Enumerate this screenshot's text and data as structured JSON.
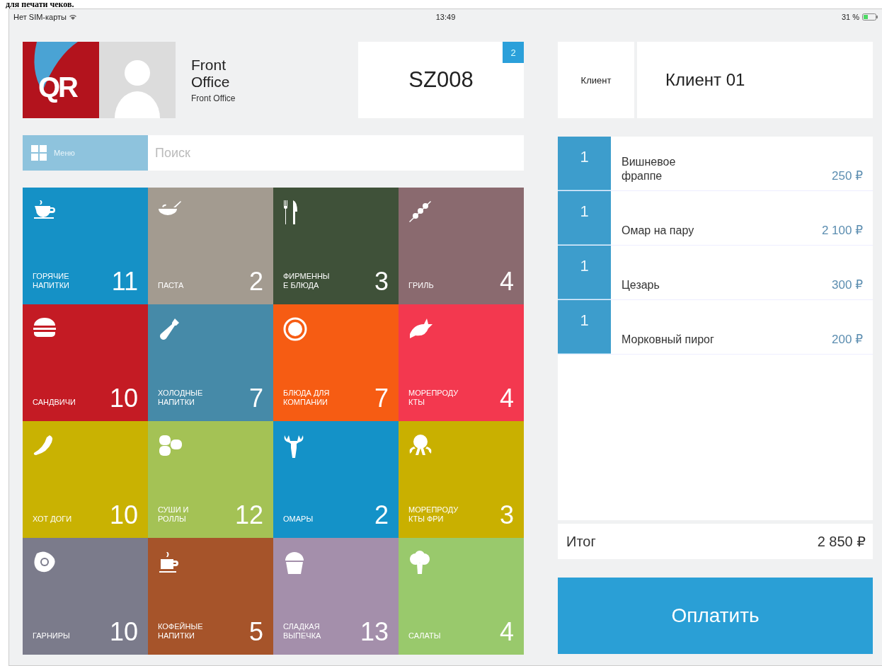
{
  "caption": "для печати чеков.",
  "status_bar": {
    "carrier": "Нет SIM-карты",
    "time": "13:49",
    "battery": "31 %"
  },
  "user": {
    "logo": "QR",
    "name": "Front Office",
    "role": "Front Office"
  },
  "order": {
    "number": "SZ008",
    "badge": "2"
  },
  "menu_button": "Меню",
  "search": {
    "placeholder": "Поиск"
  },
  "categories": [
    {
      "label": "ГОРЯЧИЕ\nНАПИТКИ",
      "count": "11",
      "color": "#1591c6"
    },
    {
      "label": "ПАСТА",
      "count": "2",
      "color": "#a39b90"
    },
    {
      "label": "ФИРМЕННЫ\nЕ БЛЮДА",
      "count": "3",
      "color": "#3f5139"
    },
    {
      "label": "ГРИЛЬ",
      "count": "4",
      "color": "#8a6a6f"
    },
    {
      "label": "САНДВИЧИ",
      "count": "10",
      "color": "#c41b24"
    },
    {
      "label": "ХОЛОДНЫЕ\nНАПИТКИ",
      "count": "7",
      "color": "#468aa8"
    },
    {
      "label": "БЛЮДА ДЛЯ\nКОМПАНИИ",
      "count": "7",
      "color": "#f65c13"
    },
    {
      "label": "МОРЕПРОДУ\nКТЫ",
      "count": "4",
      "color": "#f3384f"
    },
    {
      "label": "ХОТ ДОГИ",
      "count": "10",
      "color": "#c9b202"
    },
    {
      "label": "СУШИ И\nРОЛЛЫ",
      "count": "12",
      "color": "#a4c255"
    },
    {
      "label": "ОМАРЫ",
      "count": "2",
      "color": "#1492c8"
    },
    {
      "label": "МОРЕПРОДУ\nКТЫ ФРИ",
      "count": "3",
      "color": "#c9b000"
    },
    {
      "label": "ГАРНИРЫ",
      "count": "10",
      "color": "#7b7b8b"
    },
    {
      "label": "КОФЕЙНЫЕ\nНАПИТКИ",
      "count": "5",
      "color": "#a6542a"
    },
    {
      "label": "СЛАДКАЯ\nВЫПЕЧКА",
      "count": "13",
      "color": "#a48fab"
    },
    {
      "label": "САЛАТЫ",
      "count": "4",
      "color": "#99c96c"
    }
  ],
  "client": {
    "label": "Клиент",
    "value": "Клиент 01"
  },
  "order_items": [
    {
      "qty": "1",
      "name": "Вишневое\nфраппе",
      "price": "250 ₽"
    },
    {
      "qty": "1",
      "name": "Омар на пару",
      "price": "2 100 ₽"
    },
    {
      "qty": "1",
      "name": "Цезарь",
      "price": "300 ₽"
    },
    {
      "qty": "1",
      "name": "Морковный пирог",
      "price": "200 ₽"
    }
  ],
  "total": {
    "label": "Итог",
    "value": "2 850 ₽"
  },
  "pay_button": "Оплатить"
}
